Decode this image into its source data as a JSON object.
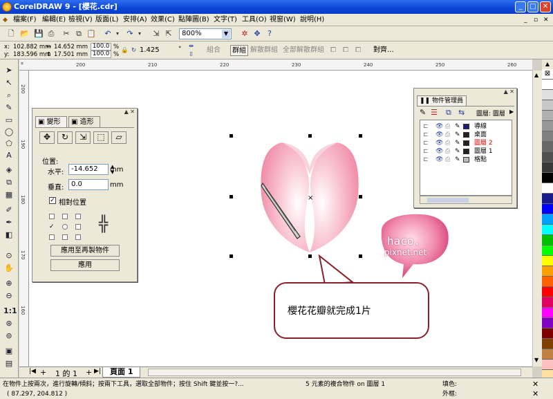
{
  "window": {
    "title": "CorelDRAW 9 - [櫻花.cdr]",
    "minimize": "_",
    "maximize": "□",
    "close": "✕"
  },
  "menus": [
    "檔案(F)",
    "編輯(E)",
    "檢視(V)",
    "版面(L)",
    "安排(A)",
    "效果(C)",
    "點陣圖(B)",
    "文字(T)",
    "工具(O)",
    "視窗(W)",
    "說明(H)"
  ],
  "toolbar": {
    "zoom": "800%"
  },
  "propbar": {
    "x_label": "x:",
    "x": "102.882 mm",
    "y_label": "y:",
    "y": "183.596 mm",
    "width": "14.652 mm",
    "height": "17.501 mm",
    "scale_w": "100.0",
    "scale_h": "100.0",
    "pct": "%",
    "angle": "1.425",
    "angle_unit": "°",
    "combine": "組合",
    "group": "群組",
    "ungroup": "解散群組",
    "ungroup_all": "全部解散群組",
    "align": "對齊..."
  },
  "transform_panel": {
    "tab_transform": "變形",
    "tab_shape": "造形",
    "position_label": "位置:",
    "h_label": "水平:",
    "h_value": "-14.652",
    "v_label": "垂直:",
    "v_value": "0.0",
    "unit": "mm",
    "relative_label": "相對位置",
    "relative_checked": true,
    "apply_copy": "應用至再製物件",
    "apply": "應用"
  },
  "object_manager": {
    "title": "物件管理員",
    "layer_label": "圖層: 圖層",
    "layers": [
      {
        "name": "導線",
        "color": "#1e1e78"
      },
      {
        "name": "桌面",
        "color": "#222222"
      },
      {
        "name": "圖層 2",
        "color": "#222222",
        "active": true
      },
      {
        "name": "圖層 1",
        "color": "#222222"
      },
      {
        "name": "格點",
        "color": "#bbbbbb"
      }
    ]
  },
  "ruler_top": [
    "",
    "200",
    "",
    "210",
    "",
    "220",
    "",
    "230",
    "",
    "240",
    "",
    "250",
    "",
    "260"
  ],
  "ruler_left": [
    "200",
    "",
    "190",
    "",
    "180",
    "",
    "170",
    "",
    "160",
    ""
  ],
  "annotation": {
    "text": "櫻花花瓣就完成1片",
    "watermark_line1": "haco.",
    "watermark_line2": "pixnet.net"
  },
  "page_tabs": {
    "counter": "1 的 1",
    "page": "頁面  1"
  },
  "status": {
    "hint": "在物件上按兩次，進行旋轉/傾斜；按兩下工具，選取全部物件；按住 Shift 鍵並按一?...",
    "coords": "( 87.297, 204.812 )",
    "selection": "5 元素的複合物件 on 圖層 1",
    "fill_label": "填色:",
    "outline_label": "外框:"
  },
  "palette": [
    "#ffffff",
    "#e0e0e0",
    "#c8c8c8",
    "#b0b0b0",
    "#989898",
    "#808080",
    "#686868",
    "#505050",
    "#383838",
    "#000000",
    "#ffffff",
    "#1a1a8a",
    "#0000ff",
    "#00a0ff",
    "#00ffff",
    "#00c000",
    "#00ff00",
    "#ffff00",
    "#ffa000",
    "#ff6000",
    "#ff0000",
    "#e00060",
    "#ff00ff",
    "#8000c0",
    "#800000",
    "#804000",
    "#c08040",
    "#ffc0c0",
    "#ffe0a0"
  ]
}
